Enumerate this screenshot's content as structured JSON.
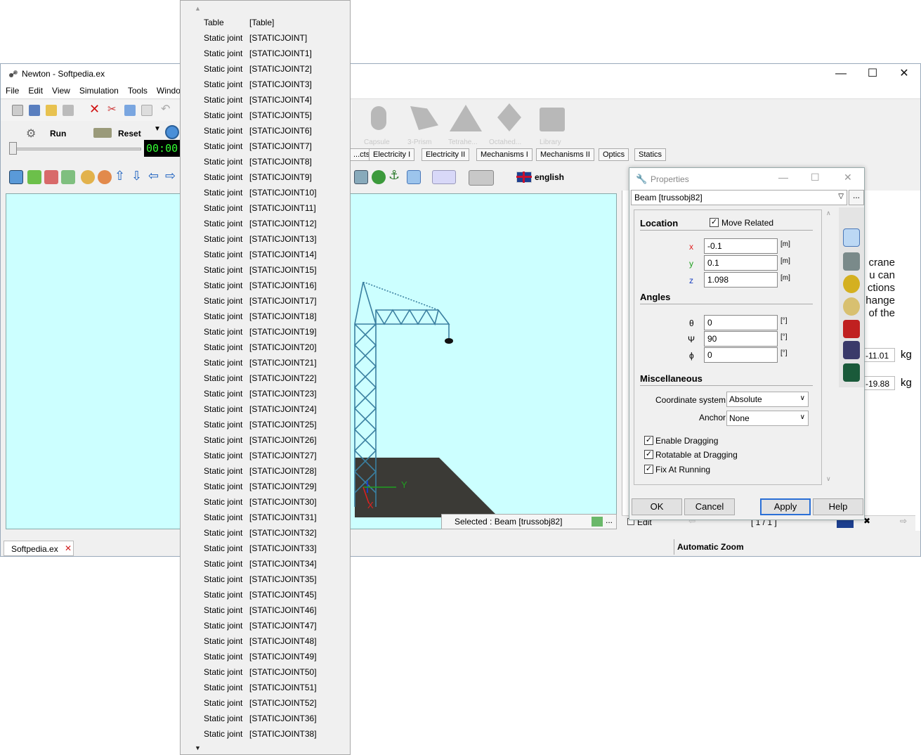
{
  "window": {
    "title": "Newton - Softpedia.ex",
    "minimize": "—",
    "maximize": "☐",
    "close": "✕"
  },
  "menu": [
    "File",
    "Edit",
    "View",
    "Simulation",
    "Tools",
    "Windo"
  ],
  "run_controls": {
    "run_label": "Run",
    "reset_label": "Reset",
    "timer": "00:00"
  },
  "palette": {
    "items": [
      "Capsule",
      "3-Prism",
      "Tetrahe...",
      "Octahed...",
      "Library"
    ]
  },
  "tabs": [
    "...cts",
    "Electricity I",
    "Electricity II",
    "Mechanisms I",
    "Mechanisms II",
    "Optics",
    "Statics"
  ],
  "language": {
    "label": "english"
  },
  "viewport": {
    "status": "Selected : Beam [trussobj82]",
    "axis_y": "Y",
    "axis_x": "X"
  },
  "doc": {
    "lines": [
      "crane",
      "u can",
      "ctions",
      "hange",
      "of the"
    ],
    "mass1": "-11.01",
    "mass2": "-19.88",
    "unit": "kg",
    "edit_label": "Edit",
    "page_indicator": "[ 1 / 1 ]"
  },
  "bottom": {
    "tab_label": "Softpedia.ex",
    "zoom_label": "Automatic Zoom"
  },
  "dropdown": {
    "up_arrow": "▲",
    "down_arrow": "▼",
    "items": [
      {
        "type": "Table",
        "id": "[Table]"
      },
      {
        "type": "Static joint",
        "id": "[STATICJOINT]"
      },
      {
        "type": "Static joint",
        "id": "[STATICJOINT1]"
      },
      {
        "type": "Static joint",
        "id": "[STATICJOINT2]"
      },
      {
        "type": "Static joint",
        "id": "[STATICJOINT3]"
      },
      {
        "type": "Static joint",
        "id": "[STATICJOINT4]"
      },
      {
        "type": "Static joint",
        "id": "[STATICJOINT5]"
      },
      {
        "type": "Static joint",
        "id": "[STATICJOINT6]"
      },
      {
        "type": "Static joint",
        "id": "[STATICJOINT7]"
      },
      {
        "type": "Static joint",
        "id": "[STATICJOINT8]"
      },
      {
        "type": "Static joint",
        "id": "[STATICJOINT9]"
      },
      {
        "type": "Static joint",
        "id": "[STATICJOINT10]"
      },
      {
        "type": "Static joint",
        "id": "[STATICJOINT11]"
      },
      {
        "type": "Static joint",
        "id": "[STATICJOINT12]"
      },
      {
        "type": "Static joint",
        "id": "[STATICJOINT13]"
      },
      {
        "type": "Static joint",
        "id": "[STATICJOINT14]"
      },
      {
        "type": "Static joint",
        "id": "[STATICJOINT15]"
      },
      {
        "type": "Static joint",
        "id": "[STATICJOINT16]"
      },
      {
        "type": "Static joint",
        "id": "[STATICJOINT17]"
      },
      {
        "type": "Static joint",
        "id": "[STATICJOINT18]"
      },
      {
        "type": "Static joint",
        "id": "[STATICJOINT19]"
      },
      {
        "type": "Static joint",
        "id": "[STATICJOINT20]"
      },
      {
        "type": "Static joint",
        "id": "[STATICJOINT21]"
      },
      {
        "type": "Static joint",
        "id": "[STATICJOINT22]"
      },
      {
        "type": "Static joint",
        "id": "[STATICJOINT23]"
      },
      {
        "type": "Static joint",
        "id": "[STATICJOINT24]"
      },
      {
        "type": "Static joint",
        "id": "[STATICJOINT25]"
      },
      {
        "type": "Static joint",
        "id": "[STATICJOINT26]"
      },
      {
        "type": "Static joint",
        "id": "[STATICJOINT27]"
      },
      {
        "type": "Static joint",
        "id": "[STATICJOINT28]"
      },
      {
        "type": "Static joint",
        "id": "[STATICJOINT29]"
      },
      {
        "type": "Static joint",
        "id": "[STATICJOINT30]"
      },
      {
        "type": "Static joint",
        "id": "[STATICJOINT31]"
      },
      {
        "type": "Static joint",
        "id": "[STATICJOINT32]"
      },
      {
        "type": "Static joint",
        "id": "[STATICJOINT33]"
      },
      {
        "type": "Static joint",
        "id": "[STATICJOINT34]"
      },
      {
        "type": "Static joint",
        "id": "[STATICJOINT35]"
      },
      {
        "type": "Static joint",
        "id": "[STATICJOINT45]"
      },
      {
        "type": "Static joint",
        "id": "[STATICJOINT46]"
      },
      {
        "type": "Static joint",
        "id": "[STATICJOINT47]"
      },
      {
        "type": "Static joint",
        "id": "[STATICJOINT48]"
      },
      {
        "type": "Static joint",
        "id": "[STATICJOINT49]"
      },
      {
        "type": "Static joint",
        "id": "[STATICJOINT50]"
      },
      {
        "type": "Static joint",
        "id": "[STATICJOINT51]"
      },
      {
        "type": "Static joint",
        "id": "[STATICJOINT52]"
      },
      {
        "type": "Static joint",
        "id": "[STATICJOINT36]"
      },
      {
        "type": "Static joint",
        "id": "[STATICJOINT38]"
      }
    ]
  },
  "properties": {
    "title": "Properties",
    "object": "Beam [trussobj82]",
    "more": "...",
    "location": {
      "heading": "Location",
      "move_related": "Move Related",
      "x_label": "x",
      "x": "-0.1",
      "y_label": "y",
      "y": "0.1",
      "z_label": "z",
      "z": "1.098",
      "unit": "[m]"
    },
    "angles": {
      "heading": "Angles",
      "theta_label": "θ",
      "theta": "0",
      "psi_label": "Ψ",
      "psi": "90",
      "phi_label": "ϕ",
      "phi": "0",
      "unit": "[°]"
    },
    "misc": {
      "heading": "Miscellaneous",
      "coord_label": "Coordinate system",
      "coord_value": "Absolute",
      "anchor_label": "Anchor",
      "anchor_value": "None",
      "enable_dragging": "Enable Dragging",
      "rotatable": "Rotatable at Dragging",
      "fix_running": "Fix At Running"
    },
    "buttons": {
      "ok": "OK",
      "cancel": "Cancel",
      "apply": "Apply",
      "help": "Help"
    }
  },
  "colors": {
    "viewport_bg": "#ccffff",
    "crane": "#3a7fa0",
    "ground": "#3b3a36",
    "timer_bg": "#000000",
    "timer_fg": "#33ff33",
    "axis_x": "#e02020",
    "axis_y": "#20a020",
    "apply_border": "#2a6fd6"
  }
}
